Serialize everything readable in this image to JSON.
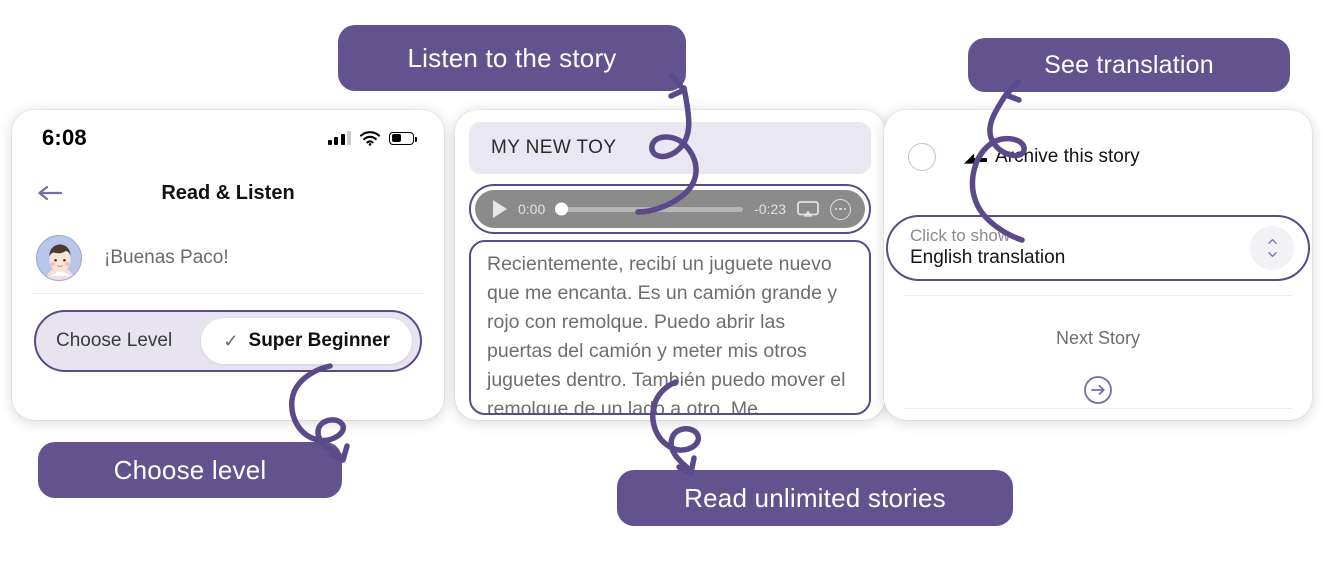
{
  "callouts": [
    {
      "id": "listen",
      "label": "Listen to the story"
    },
    {
      "id": "translation",
      "label": "See translation"
    },
    {
      "id": "level",
      "label": "Choose level"
    },
    {
      "id": "read",
      "label": "Read unlimited stories"
    }
  ],
  "colors": {
    "bubble_purple": "#62538f",
    "outline_purple": "#5a4a8a",
    "arrow_purple": "#5a4a8a",
    "lavender_fill": "#e7e4f0",
    "player_gray": "#8b8b8b",
    "body_text_gray": "#6e6e6e"
  },
  "left_phone": {
    "status": {
      "clock": "6:08",
      "cellular_icon": "cellular-bars-icon",
      "wifi_icon": "wifi-icon",
      "battery_icon": "battery-icon",
      "battery_percent": 43
    },
    "nav": {
      "back_icon": "arrow-left-icon",
      "title": "Read & Listen"
    },
    "greeting": {
      "avatar_icon": "user-avatar",
      "text": "¡Buenas Paco!"
    },
    "level_selector": {
      "label": "Choose Level",
      "check_icon": "check-icon",
      "value": "Super Beginner"
    }
  },
  "middle_phone": {
    "story_title": "MY NEW TOY",
    "player": {
      "play_icon": "play-icon",
      "current_time": "0:00",
      "remaining_time": "-0:23",
      "progress_percent": 0,
      "airplay_icon": "airplay-icon",
      "more_icon": "more-options-icon"
    },
    "story_text": "Recientemente, recibí un juguete nuevo que me encanta. Es un camión grande y rojo con remolque. Puedo abrir las puertas del camión y meter mis otros juguetes dentro. También puedo mover el remolque de un lado a otro. Me"
  },
  "right_phone": {
    "archive": {
      "radio_icon": "radio-unchecked-icon",
      "flag_icon": "flag-icon",
      "label": "Archive this story"
    },
    "translation": {
      "hint": "Click to show",
      "value": "English translation",
      "stepper_icon": "chevron-up-down-icon"
    },
    "next": {
      "label": "Next Story",
      "arrow_icon": "arrow-right-circle-icon"
    }
  }
}
